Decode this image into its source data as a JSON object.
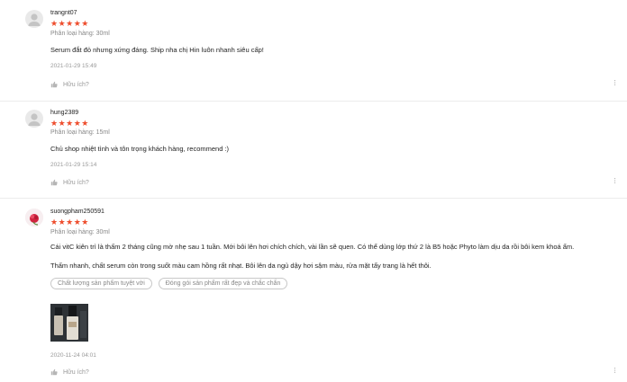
{
  "reviews": [
    {
      "username": "trangnt07",
      "stars": "★★★★★",
      "variant": "Phân loại hàng: 30ml",
      "content": "Serum đắt đỏ nhưng xứng đáng. Ship nha chị Hin luôn nhanh siêu cấp!",
      "timestamp": "2021-01-29 15:49",
      "helpful": "Hữu ích?",
      "more": "···"
    },
    {
      "username": "hung2389",
      "stars": "★★★★★",
      "variant": "Phân loại hàng: 15ml",
      "content": "Chủ shop nhiệt tình và tôn trọng khách hàng, recommend :)",
      "timestamp": "2021-01-29 15:14",
      "helpful": "Hữu ích?",
      "more": "···"
    },
    {
      "username": "suongpham250591",
      "stars": "★★★★★",
      "variant": "Phân loại hàng: 30ml",
      "content_line1": "Cái vitC kiên trì là thấm 2 tháng cũng mờ nhẹ sau 1 tuần. Mới bôi lên hơi chích chích, vài lần sẽ quen. Có thể dùng lớp thứ 2 là B5 hoặc Phyto làm dịu da rồi bôi kem khoá ẩm.",
      "content_line2": "Thấm nhanh, chất serum còn trong suốt màu cam hồng rất nhạt. Bôi lên da ngủ dậy hơi sậm màu, rửa mặt tẩy trang là hết thôi.",
      "tags": [
        "Chất lượng sản phẩm tuyệt vời",
        "Đóng gói sản phẩm rất đẹp và chắc chắn"
      ],
      "timestamp": "2020-11-24 04:01",
      "helpful": "Hữu ích?",
      "more": "···"
    }
  ],
  "colors": {
    "star": "#ee4d2d",
    "muted": "#999999",
    "text": "#222222"
  },
  "icons": {
    "like": "thumbs-up-icon",
    "default_avatar": "user-avatar-icon",
    "more": "more-options-icon"
  }
}
